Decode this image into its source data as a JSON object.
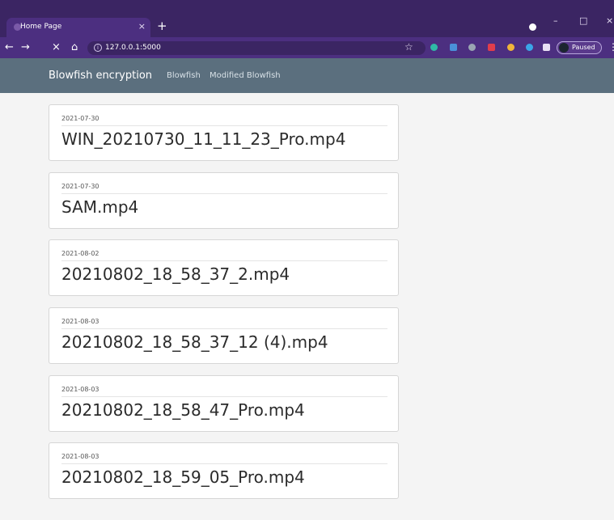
{
  "browser": {
    "tab_title": "Home Page",
    "tab_close": "×",
    "new_tab": "+",
    "url": "127.0.0.1:5000",
    "profile_label": "Paused",
    "window_min": "–",
    "window_max": "□",
    "window_close": "×",
    "back": "←",
    "forward": "→",
    "stop": "×",
    "home": "⌂",
    "info": "i",
    "star": "☆",
    "menu": "⋮",
    "theme_color": "#3b2563"
  },
  "navbar": {
    "brand": "Blowfish encryption",
    "links": [
      "Blowfish",
      "Modified Blowfish"
    ],
    "color": "#5b6f7e"
  },
  "videos": [
    {
      "date": "2021-07-30",
      "name": "WIN_20210730_11_11_23_Pro.mp4"
    },
    {
      "date": "2021-07-30",
      "name": "SAM.mp4"
    },
    {
      "date": "2021-08-02",
      "name": "20210802_18_58_37_2.mp4"
    },
    {
      "date": "2021-08-03",
      "name": "20210802_18_58_37_12 (4).mp4"
    },
    {
      "date": "2021-08-03",
      "name": "20210802_18_58_47_Pro.mp4"
    },
    {
      "date": "2021-08-03",
      "name": "20210802_18_59_05_Pro.mp4"
    }
  ]
}
